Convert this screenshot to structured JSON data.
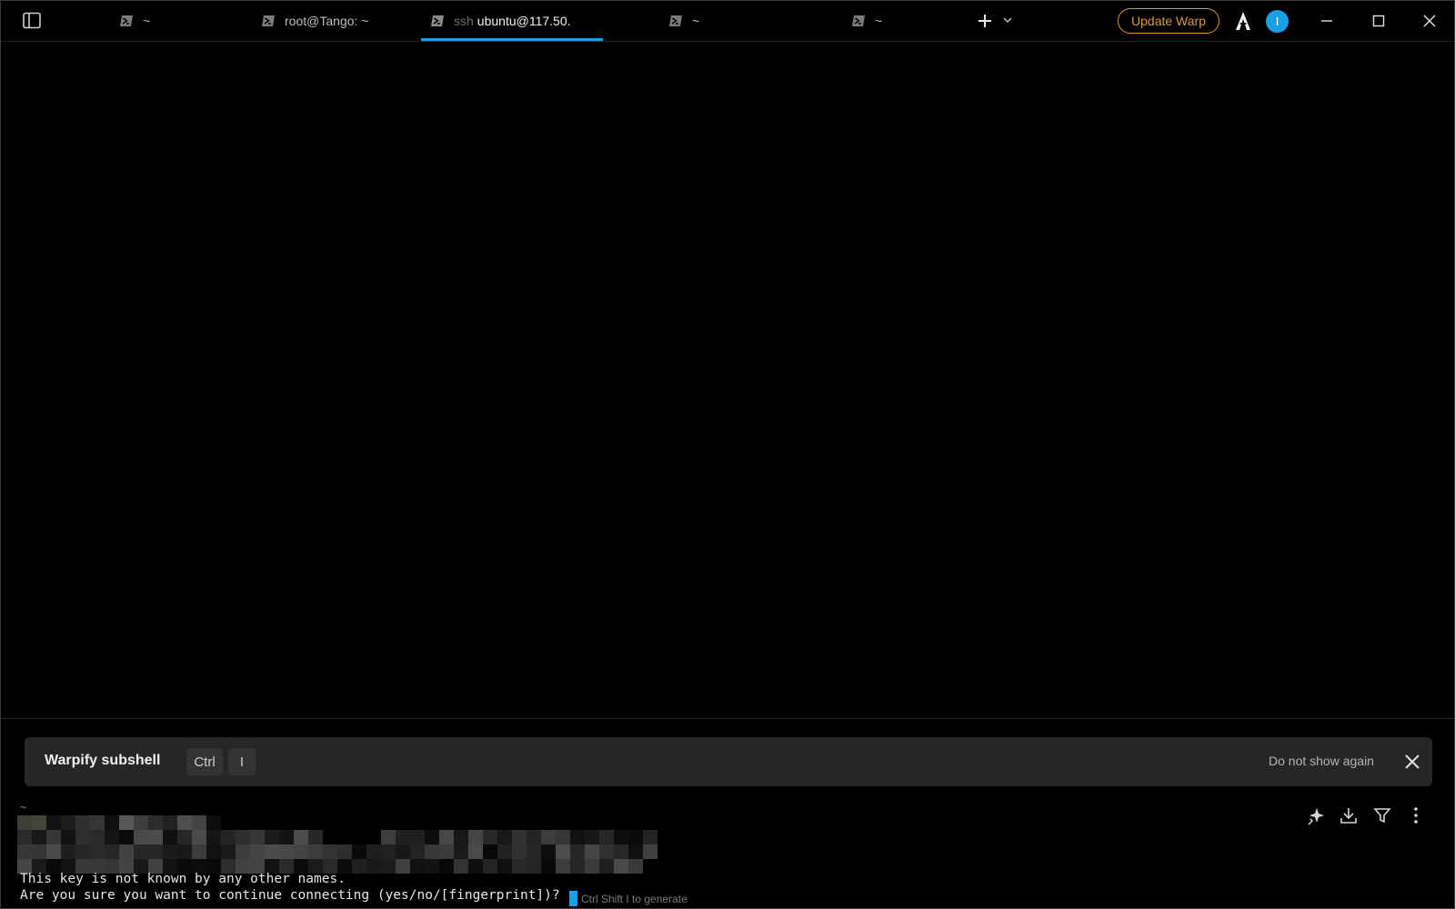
{
  "titlebar": {
    "tabs": [
      {
        "label": "~",
        "prefix": "",
        "active": false
      },
      {
        "label": "root@Tango: ~",
        "prefix": "",
        "active": false
      },
      {
        "label": "ubuntu@117.50.",
        "prefix": "ssh",
        "active": true
      },
      {
        "label": "~",
        "prefix": "",
        "active": false
      },
      {
        "label": "~",
        "prefix": "",
        "active": false
      }
    ],
    "update_label": "Update Warp",
    "avatar_initial": "I"
  },
  "banner": {
    "title": "Warpify subshell",
    "keys": [
      "Ctrl",
      "I"
    ],
    "dismiss_label": "Do not show again"
  },
  "terminal": {
    "cwd": "~",
    "lines": [
      "This key is not known by any other names.",
      "Are you sure you want to continue connecting (yes/no/[fingerprint])?"
    ],
    "hint": "Ctrl Shift I to generate"
  },
  "colors": {
    "accent": "#1aa0e0",
    "update": "#e2962b",
    "background": "#000000",
    "banner": "#262626"
  },
  "icons": {
    "sidebar": "sidebar-toggle-icon",
    "tab": "powershell-icon",
    "new_tab": "plus-icon",
    "tab_menu": "chevron-down-icon",
    "logo": "warp-logo-icon",
    "minimize": "minimize-icon",
    "maximize": "maximize-icon",
    "close": "close-icon",
    "ai": "sparkle-icon",
    "save": "download-icon",
    "filter": "filter-icon",
    "more": "more-vertical-icon"
  }
}
